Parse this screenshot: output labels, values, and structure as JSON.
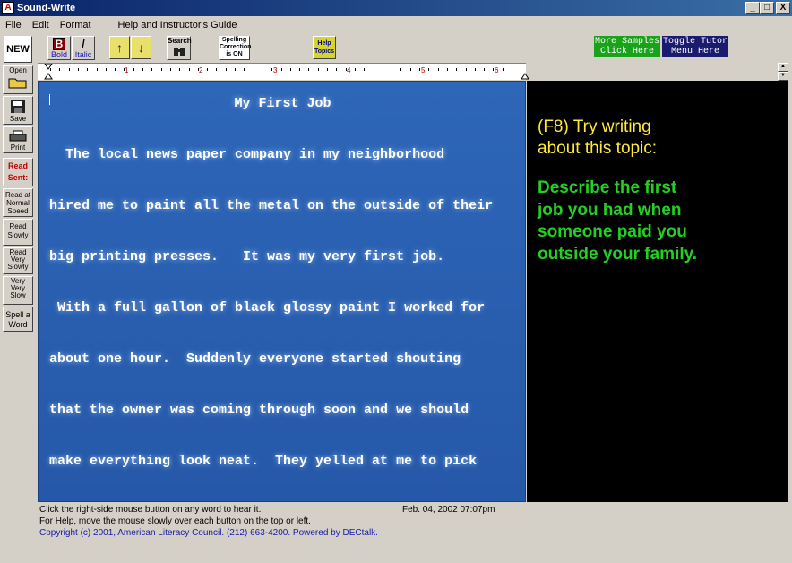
{
  "window": {
    "title": "Sound-Write",
    "app_icon": "A",
    "controls": {
      "minimize": "_",
      "maximize": "□",
      "close": "X"
    }
  },
  "menu": [
    "File",
    "Edit",
    "Format",
    "Help and Instructor's Guide"
  ],
  "toolbar": {
    "new_label": "NEW",
    "bold_glyph": "B",
    "bold_label": "Bold",
    "italic_glyph": "/",
    "italic_label": "Italic",
    "line_up": "↑",
    "line_down": "↓",
    "search_label": "Search",
    "spell_label_1": "Spelling",
    "spell_label_2": "Correction",
    "spell_label_3": "is ON",
    "help_topics_1": "Help",
    "help_topics_2": "Topics",
    "samples_1": "More Samples",
    "samples_2": "Click Here",
    "tutor_1": "Toggle Tutor",
    "tutor_2": "Menu  Here"
  },
  "ruler": {
    "numbers": [
      "1",
      "2",
      "3",
      "4",
      "5",
      "6"
    ]
  },
  "sidebar": {
    "open": "Open",
    "save": "Save",
    "print": "Print",
    "read_sent_1": "Read",
    "read_sent_2": "Sent:",
    "normal_1": "Read at",
    "normal_2": "Normal",
    "normal_3": "Speed",
    "slow_1": "Read",
    "slow_2": "Slowly",
    "veryslow_1": "Read",
    "veryslow_2": "Very",
    "veryslow_3": "Slowly",
    "vvslow_1": "Very",
    "vvslow_2": "Very",
    "vvslow_3": "Slow",
    "spell_1": "Spell a",
    "spell_2": "Word"
  },
  "document": {
    "title": "My First Job",
    "lines": [
      "  The local news paper company in my neighborhood",
      "hired me to paint all the metal on the outside of their",
      "big printing presses.   It was my very first job.",
      " With a full gallon of black glossy paint I worked for",
      "about one hour.  Suddenly everyone started shouting",
      "that the owner was coming through soon and we should",
      "make everything look neat.  They yelled at me to pick"
    ]
  },
  "tutor": {
    "prompt_1": "(F8) Try writing",
    "prompt_2": "about this topic:",
    "topic_1": "Describe the first",
    "topic_2": "job you had when",
    "topic_3": "someone paid you",
    "topic_4": "outside your family."
  },
  "status": {
    "line1": "Click the right-side mouse button on any word to hear it.",
    "date": "Feb. 04, 2002  07:07pm",
    "line2": "For Help, move the mouse slowly over each button on the top or left.",
    "line3": "Copyright (c) 2001, American Literacy Council.  (212) 663-4200.   Powered by DECtalk."
  },
  "colors": {
    "editor_bg": "#2c63b5",
    "tutor_bg": "#000000",
    "prompt_yellow": "#ffe93a",
    "topic_green": "#23d023",
    "samples_green": "#1aa31a",
    "tutor_navy": "#1a1a6e"
  }
}
